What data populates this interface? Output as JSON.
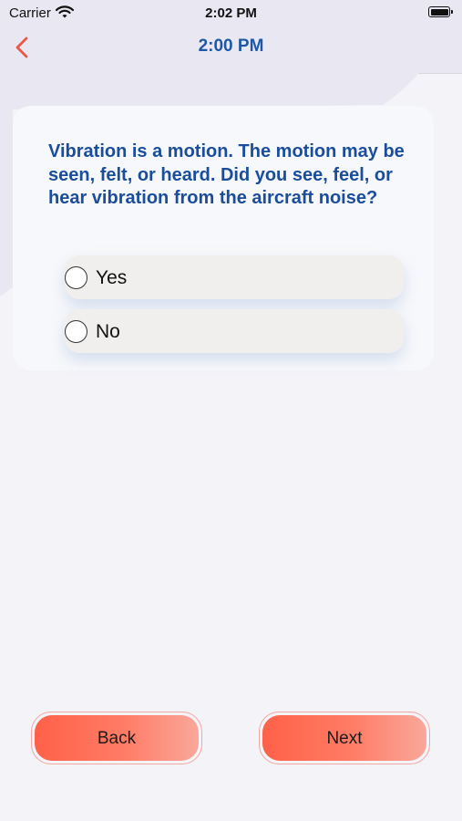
{
  "status_bar": {
    "carrier": "Carrier",
    "time": "2:02 PM"
  },
  "nav": {
    "title": "2:00 PM",
    "back_icon": "chevron-left-icon",
    "accent_color": "#e8574a"
  },
  "question": {
    "text": "Vibration is a motion. The motion may be seen, felt, or heard. Did you see, feel, or hear vibration from the aircraft noise?",
    "color": "#1a4d9c"
  },
  "options": [
    {
      "label": "Yes",
      "selected": false
    },
    {
      "label": "No",
      "selected": false
    }
  ],
  "buttons": {
    "back_label": "Back",
    "next_label": "Next",
    "color": "#ff6148"
  }
}
